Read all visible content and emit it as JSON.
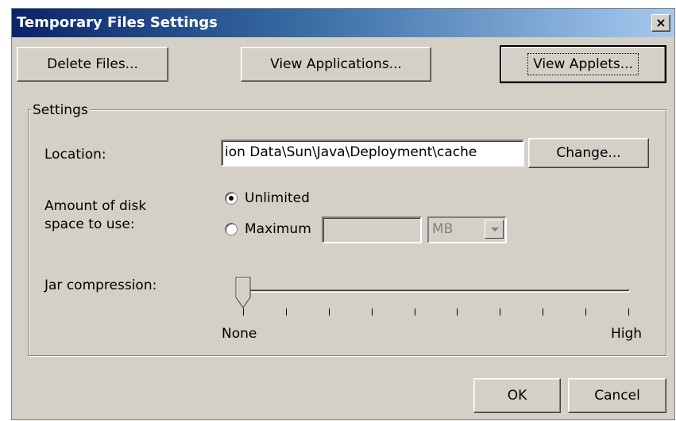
{
  "window": {
    "title": "Temporary Files Settings",
    "close_glyph": "×"
  },
  "buttons": {
    "delete_files": "Delete Files...",
    "view_applications": "View Applications...",
    "view_applets": "View Applets..."
  },
  "settings": {
    "group_label": "Settings",
    "location_label": "Location:",
    "location_value": "ion Data\\Sun\\Java\\Deployment\\cache",
    "change_button": "Change...",
    "disk_space_label_line1": "Amount of disk",
    "disk_space_label_line2": "space to use:",
    "radio_unlimited": "Unlimited",
    "radio_maximum": "Maximum",
    "selected_option": "Unlimited",
    "maximum_value": "",
    "unit_value": "MB",
    "jar_compression_label": "Jar compression:",
    "slider_min_label": "None",
    "slider_max_label": "High",
    "slider_level": 0,
    "slider_steps": 9
  },
  "footer": {
    "ok": "OK",
    "cancel": "Cancel"
  }
}
